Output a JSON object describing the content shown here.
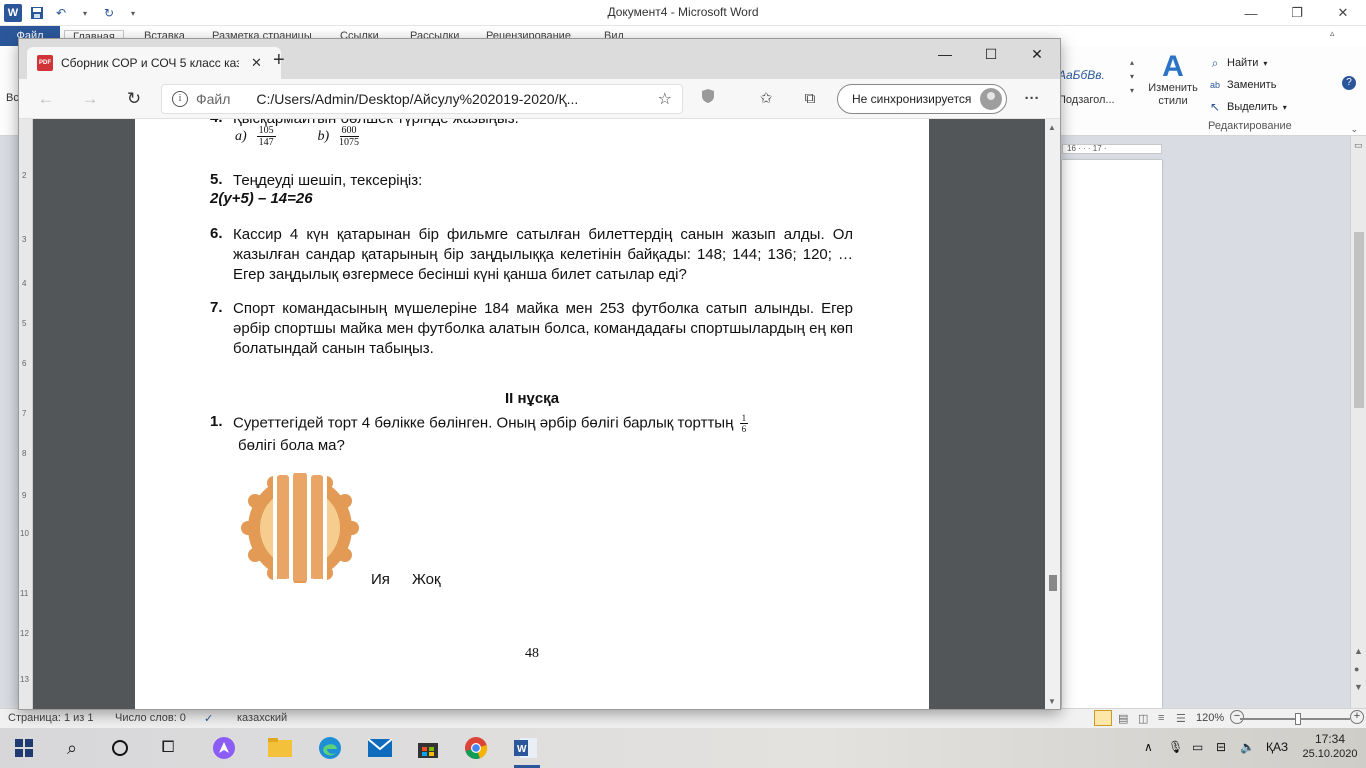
{
  "word": {
    "title": "Документ4  -  Microsoft Word",
    "tabs": [
      "Файл",
      "Главная",
      "Вставка",
      "Разметка страницы",
      "Ссылки",
      "Рассылки",
      "Рецензирование",
      "Вид"
    ],
    "styles_samples": [
      "АаБбВв.",
      "Подзагол..."
    ],
    "change_styles_label": "Изменить стили",
    "editing": {
      "find": "Найти",
      "replace": "Заменить",
      "select": "Выделить",
      "group_label": "Редактирование"
    },
    "ruler_text": "16 · · · 17 ·",
    "status": {
      "page": "Страница: 1 из 1",
      "words": "Число слов: 0",
      "language": "казахский",
      "zoom": "120%"
    }
  },
  "edge": {
    "tab_title": "Сборник СОР и СОЧ 5 класс каз",
    "address_prefix": "Файл",
    "address_url": "C:/Users/Admin/Desktop/Айсулу%202019-2020/Қ...",
    "sync_label": "Не синхронизируется"
  },
  "pdf": {
    "q4": {
      "partial_text": "Қысқармайтын бөлшек түрінде жазыңыз.",
      "a_label": "a)",
      "a_num": "105",
      "a_den": "147",
      "b_label": "b)",
      "b_num": "600",
      "b_den": "1075"
    },
    "q5": {
      "num": "5.",
      "text": "Теңдеуді шешіп, тексеріңіз:",
      "equation": "2(y+5) – 14=26"
    },
    "q6": {
      "num": "6.",
      "text": "Кассир 4 күн қатарынан бір фильмге сатылған билеттердің санын жазып алды. Ол жазылған сандар қатарының бір заңдылыққа келетінін байқады: 148; 144; 136; 120; … Егер заңдылық өзгермесе бесінші күні қанша билет сатылар еді?"
    },
    "q7": {
      "num": "7.",
      "text": "Спорт командасының мүшелеріне 184 майка мен 253 футболка сатып алынды. Егер әрбір спортшы майка мен футболка алатын болса, командадағы спортшылардың ең көп болатындай  санын табыңыз."
    },
    "variant_heading": "ІІ нұсқа",
    "v2q1": {
      "num": "1.",
      "text_before": "Суреттегідей торт 4 бөлікке бөлінген.  Оның әрбір бөлігі барлық торттың",
      "frac_num": "1",
      "frac_den": "6",
      "text_after": "бөлігі бола ма?",
      "answer_yes": "Ия",
      "answer_no": "Жоқ"
    },
    "page_number": "48",
    "ruler_marks": [
      "2",
      "3",
      "4",
      "5",
      "6",
      "7",
      "8",
      "9",
      "10",
      "11",
      "12",
      "13"
    ]
  },
  "taskbar": {
    "language": "ҚАЗ",
    "time": "17:34",
    "date": "25.10.2020"
  },
  "colors": {
    "word_blue": "#2b579a",
    "pie_crust": "#e39a55",
    "pie_fill": "#f6cd8f",
    "pie_berry": "#c8414b"
  }
}
